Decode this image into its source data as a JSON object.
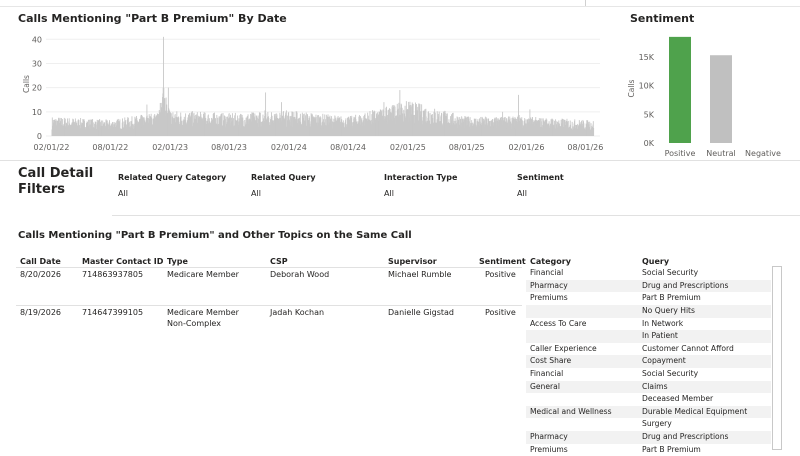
{
  "timeline": {
    "title": "Calls Mentioning \"Part B Premium\" By Date",
    "ylabel": "Calls",
    "yticks": [
      "0",
      "10",
      "20",
      "30",
      "40"
    ],
    "xticks": [
      "02/01/22",
      "08/01/22",
      "02/01/23",
      "08/01/23",
      "02/01/24",
      "08/01/24",
      "02/01/25",
      "08/01/25",
      "02/01/26",
      "08/01/26"
    ]
  },
  "sentiment_chart": {
    "title": "Sentiment",
    "ylabel": "Calls",
    "yticks": [
      "0K",
      "5K",
      "10K",
      "15K"
    ],
    "categories": [
      "Positive",
      "Neutral",
      "Negative"
    ]
  },
  "chart_data": [
    {
      "type": "bar",
      "title": "Calls Mentioning \"Part B Premium\" By Date",
      "ylabel": "Calls",
      "ylim": [
        0,
        43
      ],
      "x_range": [
        "2022-01-15",
        "2026-09-15"
      ],
      "x": [
        "2022-02-01",
        "2022-08-01",
        "2023-02-01",
        "2023-08-01",
        "2024-02-01",
        "2024-08-01",
        "2025-02-01",
        "2025-08-01",
        "2026-02-01",
        "2026-08-01"
      ],
      "series": [
        {
          "values": [
            6,
            5,
            8,
            7,
            8,
            6,
            11,
            6,
            6,
            5
          ],
          "peaks": [
            {
              "date": "2022-11-20",
              "value": 13
            },
            {
              "date": "2023-01-10",
              "value": 41
            },
            {
              "date": "2023-01-25",
              "value": 20
            },
            {
              "date": "2023-11-20",
              "value": 18
            },
            {
              "date": "2024-01-08",
              "value": 14
            },
            {
              "date": "2024-11-18",
              "value": 14
            },
            {
              "date": "2025-01-06",
              "value": 19
            },
            {
              "date": "2025-11-18",
              "value": 10
            },
            {
              "date": "2026-01-06",
              "value": 17
            },
            {
              "date": "2026-02-10",
              "value": 11
            }
          ]
        }
      ],
      "color": "#c8c8c8"
    },
    {
      "type": "bar",
      "title": "Sentiment",
      "ylabel": "Calls",
      "categories": [
        "Positive",
        "Neutral",
        "Negative"
      ],
      "values": [
        18500,
        15300,
        0
      ],
      "ylim": [
        0,
        19000
      ],
      "colors": [
        "#4fa24c",
        "#c0c0c0",
        "#c0c0c0"
      ]
    }
  ],
  "filters": {
    "title": "Call Detail Filters",
    "items": [
      {
        "label": "Related Query Category",
        "value": "All"
      },
      {
        "label": "Related Query",
        "value": "All"
      },
      {
        "label": "Interaction Type",
        "value": "All"
      },
      {
        "label": "Sentiment",
        "value": "All"
      }
    ]
  },
  "table": {
    "title": "Calls Mentioning \"Part B Premium\" and Other Topics on the Same Call",
    "headers": {
      "call_date": "Call Date",
      "master_contact_id": "Master Contact ID",
      "type": "Type",
      "csp": "CSP",
      "supervisor": "Supervisor",
      "sentiment": "Sentiment",
      "category": "Category",
      "query": "Query"
    },
    "rows": [
      {
        "call_date": "8/20/2026",
        "master_contact_id": "714863937805",
        "type": "Medicare Member",
        "csp": "Deborah Wood",
        "supervisor": "Michael Rumble",
        "sentiment": "Positive"
      },
      {
        "call_date": "8/19/2026",
        "master_contact_id": "714647399105",
        "type": "Medicare Member Non-Complex",
        "csp": "Jadah Kochan",
        "supervisor": "Danielle Gigstad",
        "sentiment": "Positive"
      }
    ],
    "queries": [
      {
        "category": "Financial",
        "query": "Social Security"
      },
      {
        "category": "Pharmacy",
        "query": "Drug and Prescriptions"
      },
      {
        "category": "Premiums",
        "query": "Part B Premium"
      },
      {
        "category": "",
        "query": "No Query Hits"
      },
      {
        "category": "Access To Care",
        "query": "In Network"
      },
      {
        "category": "",
        "query": "In Patient"
      },
      {
        "category": "Caller Experience",
        "query": "Customer Cannot Afford"
      },
      {
        "category": "Cost Share",
        "query": "Copayment"
      },
      {
        "category": "Financial",
        "query": "Social Security"
      },
      {
        "category": "General",
        "query": "Claims"
      },
      {
        "category": "",
        "query": "Deceased Member"
      },
      {
        "category": "Medical and Wellness",
        "query": "Durable Medical Equipment"
      },
      {
        "category": "",
        "query": "Surgery"
      },
      {
        "category": "Pharmacy",
        "query": "Drug and Prescriptions"
      },
      {
        "category": "Premiums",
        "query": "Part B Premium"
      }
    ]
  }
}
